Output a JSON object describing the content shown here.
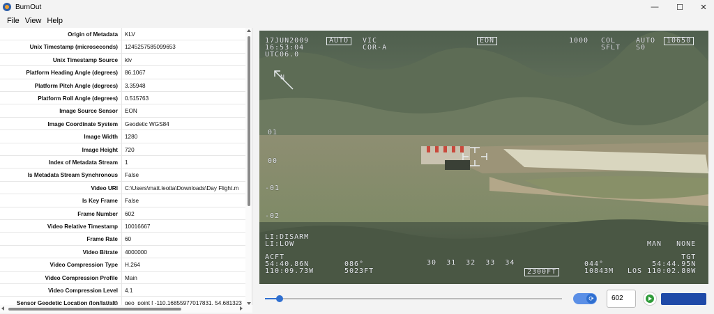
{
  "window": {
    "title": "BurnOut",
    "minimize": "—",
    "maximize": "☐",
    "close": "✕"
  },
  "menu": [
    "File",
    "View",
    "Help"
  ],
  "metadata": [
    {
      "key": "Origin of Metadata",
      "value": "KLV"
    },
    {
      "key": "Unix Timestamp (microseconds)",
      "value": "1245257585099653"
    },
    {
      "key": "Unix Timestamp Source",
      "value": "klv"
    },
    {
      "key": "Platform Heading Angle (degrees)",
      "value": "86.1067"
    },
    {
      "key": "Platform Pitch Angle (degrees)",
      "value": "3.35948"
    },
    {
      "key": "Platform Roll Angle (degrees)",
      "value": "0.515763"
    },
    {
      "key": "Image Source Sensor",
      "value": "EON"
    },
    {
      "key": "Image Coordinate System",
      "value": "Geodetic WGS84"
    },
    {
      "key": "Image Width",
      "value": "1280"
    },
    {
      "key": "Image Height",
      "value": "720"
    },
    {
      "key": "Index of Metadata Stream",
      "value": "1"
    },
    {
      "key": "Is Metadata Stream Synchronous",
      "value": "False"
    },
    {
      "key": "Video URI",
      "value": "C:\\Users\\matt.leotta\\Downloads\\Day Flight.m"
    },
    {
      "key": "Is Key Frame",
      "value": "False"
    },
    {
      "key": "Frame Number",
      "value": "602"
    },
    {
      "key": "Video Relative Timestamp",
      "value": "10016667"
    },
    {
      "key": "Frame Rate",
      "value": "60"
    },
    {
      "key": "Video Bitrate",
      "value": "4000000"
    },
    {
      "key": "Video Compression Type",
      "value": "H.264"
    },
    {
      "key": "Video Compression Profile",
      "value": "Main"
    },
    {
      "key": "Video Compression Level",
      "value": "4.1"
    },
    {
      "key": "Sensor Geodetic Location (lon/lat/alt)",
      "value": "geo_point [ -110.16855977017831, 54.681323"
    }
  ],
  "hud": {
    "date_time": "17JUN2009\n16:53:04\nUTC06.0",
    "mode_auto": "AUTO",
    "vic": "VIC\nCOR-A",
    "sensor": "EON",
    "range_1000": "1000",
    "col": "COL\nSFLT",
    "auto_s0": "AUTO\nS0",
    "zoom_box": "10650",
    "north": "N",
    "scale_01": "01",
    "scale_00": "00",
    "scale_m01": "-01",
    "scale_m02": "-02",
    "li_status": "LI:DISARM\nLI:LOW",
    "man_none": "MAN   NONE",
    "acft_lat": "ACFT\n54:40.86N\n110:09.73W",
    "heading_086": "086°\n5023FT",
    "compass": "30  31  32  33  34",
    "alt_box": "2300FT",
    "dist": "044°\n10843M",
    "tgt": "TGT\n54:44.95N\nLOS 110:02.80W"
  },
  "controls": {
    "progress": 0.05,
    "frame_value": "602",
    "loop_icon": "⟳"
  }
}
